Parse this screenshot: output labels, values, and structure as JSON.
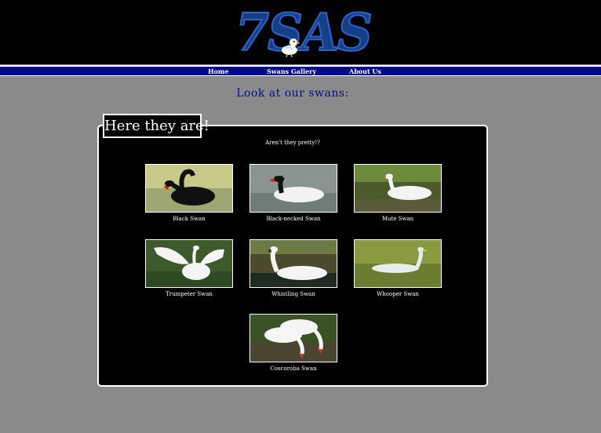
{
  "logo": {
    "text": "7SAS"
  },
  "nav": {
    "items": [
      "Home",
      "Swans Gallery",
      "About Us"
    ]
  },
  "heading": "Look at our swans:",
  "panel": {
    "tab_label": "Here they are!",
    "subtitle": "Aren't they pretty!?"
  },
  "gallery": [
    {
      "caption": "Black Swan"
    },
    {
      "caption": "Black-necked Swan"
    },
    {
      "caption": "Mute Swan"
    },
    {
      "caption": "Trumpeter Swan"
    },
    {
      "caption": "Whistling Swan"
    },
    {
      "caption": "Whooper Swan"
    },
    {
      "caption": "Coscoroba Swan"
    }
  ],
  "colors": {
    "page_bg": "#8a8a8a",
    "header_bg": "#000000",
    "nav_bg": "#030a8a",
    "heading": "#0a0a8a",
    "logo": "#163f8a"
  }
}
